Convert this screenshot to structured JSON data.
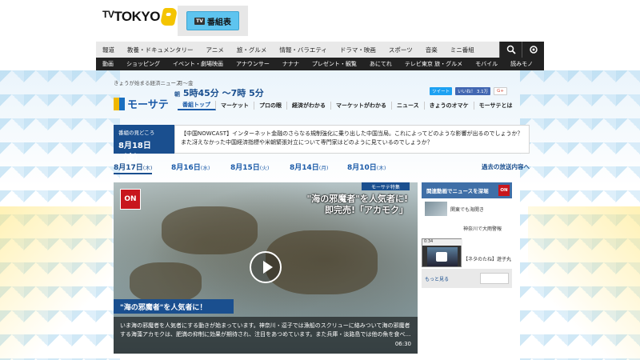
{
  "header": {
    "logo_text": "TOKYO",
    "logo_prefix": "TV",
    "guide_icon_text": "TV",
    "guide_label": "番組表"
  },
  "nav_primary": [
    "報道",
    "教養・ドキュメンタリー",
    "アニメ",
    "旅・グルメ",
    "情報・バラエティ",
    "ドラマ・映画",
    "スポーツ",
    "音楽",
    "ミニ番組"
  ],
  "nav_secondary": [
    "動画",
    "ショッピング",
    "イベント・劇場映画",
    "アナウンサー",
    "ナナナ",
    "プレゼント・観覧",
    "あにてれ",
    "テレビ東京 旅・グルメ",
    "モバイル",
    "読みモノ"
  ],
  "program": {
    "tagline": "きょうが始まる経済ニュース",
    "days": "月～金",
    "time_prefix": "朝",
    "time": "5時45分 ～7時 5分",
    "name": "モーサテ",
    "social": {
      "tweet": "ツイート",
      "like": "いいね！ 3.1万",
      "gplus": "G+"
    },
    "subnav": [
      "番組トップ",
      "マーケット",
      "プロの眼",
      "経済がわかる",
      "マーケットがわかる",
      "ニュース",
      "きょうのオマケ",
      "モーサテとは"
    ]
  },
  "highlight": {
    "label": "番組の見どころ",
    "date": "8月18日（金）",
    "text": "【中国NOWCAST】インターネット金融のさらなる規制強化に乗り出した中国当局。これによってどのような影響が出るのでしょうか？また冴えなかった中国経済指標や米朝緊張対立について専門家はどのように見ているのでしょうか？"
  },
  "dates": [
    {
      "label": "8月17日",
      "dow": "(木)"
    },
    {
      "label": "8月16日",
      "dow": "(水)"
    },
    {
      "label": "8月15日",
      "dow": "(火)"
    },
    {
      "label": "8月14日",
      "dow": "(月)"
    },
    {
      "label": "8月10日",
      "dow": "(木)"
    }
  ],
  "past_link": "過去の放送内容へ",
  "video": {
    "on_logo": "ON",
    "badge": "モーサテ特集",
    "caption_line1": "\"海の邪魔者\"を人気者に!",
    "caption_line2": "即完売!「アカモク」",
    "title": "\"海の邪魔者\"を人気者に！",
    "description": "いま海の邪魔者を人気者にする動きが始まっています。神奈川・逗子では漁船のスクリューに絡みついて海の邪魔者する海藻アカモクは、肥満の抑制に効果が期待され、注目をあつめています。また兵庫・淡路島では他の魚を食べ…",
    "duration": "06:30"
  },
  "side_panel": {
    "header": "関連動画でニュースを深堀",
    "on_logo": "ON",
    "items": [
      "関東でも海開き",
      "神奈川で大雨警報",
      "【ネタのたね】遊子丸"
    ],
    "popup_bar": "0:34",
    "foot": "もっと見る"
  }
}
